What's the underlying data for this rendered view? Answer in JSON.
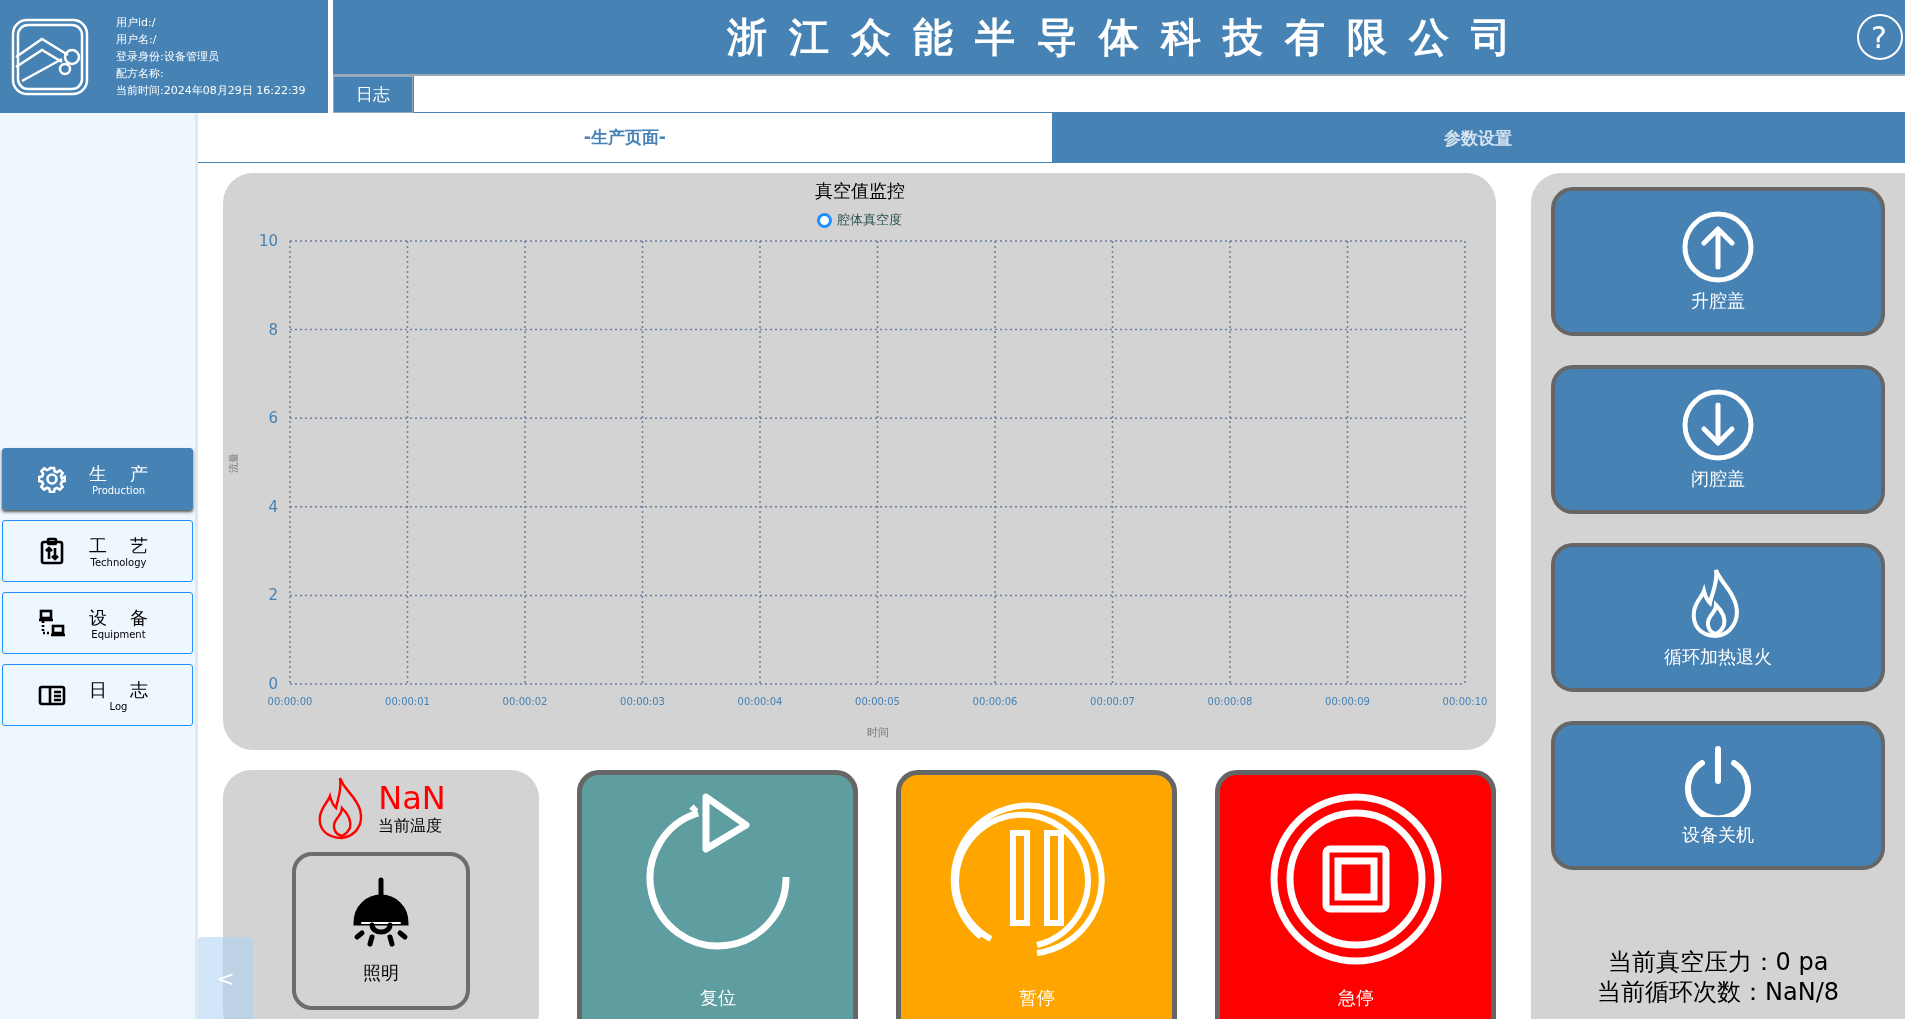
{
  "user_info": [
    "用户id:/",
    "用户名:/",
    "登录身份:设备管理员",
    "配方名称:",
    "当前时间:2024年08月29日 16:22:39"
  ],
  "title": "浙江众能半导体科技有限公司",
  "help": {
    "label": "?"
  },
  "log_tab": {
    "label": "日志"
  },
  "sidebar": {
    "items": [
      {
        "kind": "production",
        "label": "生 产",
        "sublabel": "Production",
        "selected": true
      },
      {
        "kind": "technology",
        "label": "工 艺",
        "sublabel": "Technology",
        "selected": false
      },
      {
        "kind": "equipment",
        "label": "设 备",
        "sublabel": "Equipment",
        "selected": false
      },
      {
        "kind": "log",
        "label": "日 志",
        "sublabel": "Log",
        "selected": false
      }
    ]
  },
  "tabs": [
    {
      "label": "-生产页面-",
      "selected": true
    },
    {
      "label": "参数设置",
      "selected": false
    }
  ],
  "chart": {
    "chart_data": {
      "type": "line",
      "title": "真空值监控",
      "xlabel": "时间",
      "ylabel": "流量",
      "categories": [
        "00:00:00",
        "00:00:01",
        "00:00:02",
        "00:00:03",
        "00:00:04",
        "00:00:05",
        "00:00:06",
        "00:00:07",
        "00:00:08",
        "00:00:09",
        "00:00:10"
      ],
      "series": [
        {
          "name": "腔体真空度",
          "color": "#1e90ff",
          "values": [
            null,
            null,
            null,
            null,
            null,
            null,
            null,
            null,
            null,
            null,
            null
          ]
        }
      ],
      "ylim": [
        0,
        10
      ],
      "yticks": [
        0,
        2,
        4,
        6,
        8,
        10
      ],
      "grid": true
    }
  },
  "temperature": {
    "value": "NaN",
    "label": "当前温度"
  },
  "light_button": {
    "label": "照明"
  },
  "actions": [
    {
      "kind": "reset",
      "label": "复位",
      "color": "#5f9ea0"
    },
    {
      "kind": "pause",
      "label": "暂停",
      "color": "#ffa500"
    },
    {
      "kind": "stop",
      "label": "急停",
      "color": "#ff0000"
    }
  ],
  "side_buttons": [
    {
      "kind": "up",
      "label": "升腔盖"
    },
    {
      "kind": "down",
      "label": "闭腔盖"
    },
    {
      "kind": "heat",
      "label": "循环加热退火"
    },
    {
      "kind": "power",
      "label": "设备关机"
    }
  ],
  "status": [
    "当前真空压力：0 pa",
    "当前循环次数：NaN/8"
  ],
  "back_button": {
    "label": "<"
  }
}
